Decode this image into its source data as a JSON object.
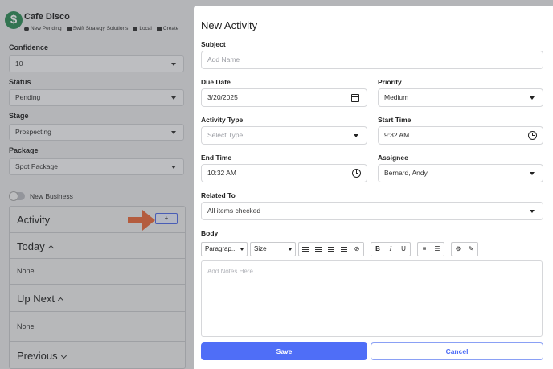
{
  "company": {
    "logo_glyph": "$",
    "name": "Cafe Disco",
    "tags": [
      "New Pending",
      "Swift Strategy Solutions",
      "Local",
      "Create"
    ]
  },
  "left": {
    "confidence_label": "Confidence",
    "confidence_value": "10",
    "status_label": "Status",
    "status_value": "Pending",
    "stage_label": "Stage",
    "stage_value": "Prospecting",
    "package_label": "Package",
    "package_value": "Spot Package",
    "toggle_label": "New Business",
    "activity_title": "Activity",
    "add_label": "+",
    "today_title": "Today",
    "today_value": "None",
    "upnext_title": "Up Next",
    "upnext_value": "None",
    "previous_title": "Previous"
  },
  "modal": {
    "title": "New Activity",
    "subject_label": "Subject",
    "subject_placeholder": "Add Name",
    "due_date_label": "Due Date",
    "due_date_value": "3/20/2025",
    "priority_label": "Priority",
    "priority_value": "Medium",
    "activity_type_label": "Activity Type",
    "activity_type_placeholder": "Select Type",
    "start_time_label": "Start Time",
    "start_time_value": "9:32 AM",
    "end_time_label": "End Time",
    "end_time_value": "10:32 AM",
    "assignee_label": "Assignee",
    "assignee_value": "Bernard, Andy",
    "related_label": "Related To",
    "related_value": "All items checked",
    "body_label": "Body",
    "paragraph_select": "Paragrap...",
    "size_select": "Size",
    "bold": "B",
    "italic": "I",
    "underline": "U",
    "body_placeholder": "Add Notes Here...",
    "save_label": "Save",
    "cancel_label": "Cancel"
  },
  "colors": {
    "accent": "#4f6ef7",
    "arrow": "#e8693c",
    "logo": "#2e8b57"
  }
}
